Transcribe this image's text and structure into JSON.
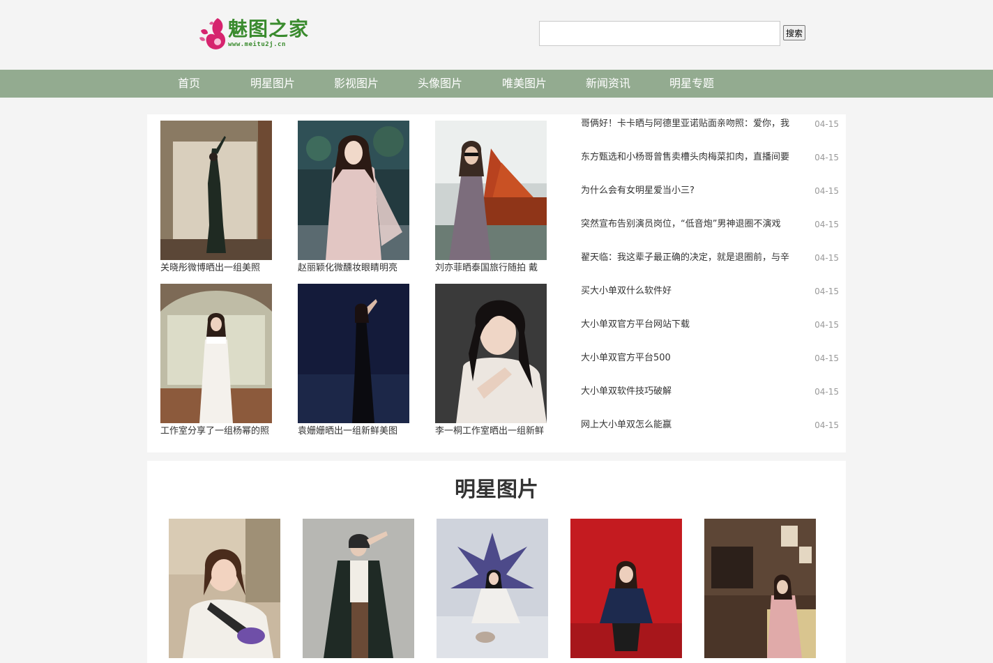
{
  "logo": {
    "title": "魅图之家",
    "url": "www.meitu2j.cn"
  },
  "search": {
    "placeholder": "",
    "value": "",
    "button_label": "搜索"
  },
  "nav": [
    "首页",
    "明星图片",
    "影视图片",
    "头像图片",
    "唯美图片",
    "新闻资讯",
    "明星专题"
  ],
  "featured": [
    {
      "caption": "关晓彤微博晒出一组美照"
    },
    {
      "caption": "赵丽颖化微醺妆眼睛明亮"
    },
    {
      "caption": "刘亦菲晒泰国旅行随拍 戴"
    },
    {
      "caption": "工作室分享了一组杨幂的照"
    },
    {
      "caption": "袁姗姗晒出一组新鲜美图"
    },
    {
      "caption": "李一桐工作室晒出一组新鲜"
    }
  ],
  "news": [
    {
      "title": "哥俩好！卡卡晒与阿德里亚诺贴面亲吻照：爱你，我",
      "date": "04-15"
    },
    {
      "title": "东方甄选和小杨哥曾售卖槽头肉梅菜扣肉，直播间要",
      "date": "04-15"
    },
    {
      "title": "为什么会有女明星爱当小三?",
      "date": "04-15"
    },
    {
      "title": "突然宣布告别演员岗位，“低音炮”男神退圈不演戏",
      "date": "04-15"
    },
    {
      "title": "翟天临：我这辈子最正确的决定，就是退圈前，与辛",
      "date": "04-15"
    },
    {
      "title": "买大小单双什么软件好",
      "date": "04-15"
    },
    {
      "title": "大小单双官方平台网站下载",
      "date": "04-15"
    },
    {
      "title": "大小单双官方平台500",
      "date": "04-15"
    },
    {
      "title": "大小单双软件技巧破解",
      "date": "04-15"
    },
    {
      "title": "网上大小单双怎么能赢",
      "date": "04-15"
    }
  ],
  "section": {
    "title": "明星图片"
  },
  "colors": {
    "nav_bg": "#93ab90",
    "logo_green": "#3a8b2e",
    "logo_pink": "#d6246e"
  }
}
